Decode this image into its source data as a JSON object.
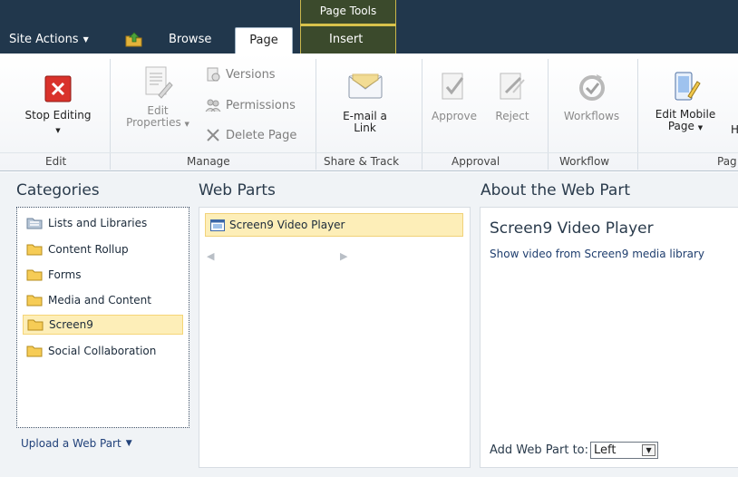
{
  "topbar": {
    "site_actions": "Site Actions",
    "context_group": "Page Tools",
    "tabs": {
      "browse": "Browse",
      "page": "Page",
      "insert": "Insert"
    }
  },
  "ribbon": {
    "stop_editing": "Stop Editing",
    "edit_properties_line1": "Edit",
    "edit_properties_line2": "Properties",
    "versions": "Versions",
    "permissions": "Permissions",
    "delete_page": "Delete Page",
    "email_link_line1": "E-mail a",
    "email_link_line2": "Link",
    "approve": "Approve",
    "reject": "Reject",
    "workflows": "Workflows",
    "edit_mobile_line1": "Edit Mobile",
    "edit_mobile_line2": "Page",
    "groups": {
      "edit": "Edit",
      "manage": "Manage",
      "share_track": "Share & Track",
      "approval": "Approval",
      "workflow": "Workflow",
      "page_partial": "Pag"
    }
  },
  "categories": {
    "title": "Categories",
    "items": [
      "Lists and Libraries",
      "Content Rollup",
      "Forms",
      "Media and Content",
      "Screen9",
      "Social Collaboration"
    ],
    "selected": "Screen9",
    "upload_link": "Upload a Web Part"
  },
  "web_parts": {
    "title": "Web Parts",
    "items": [
      "Screen9 Video Player"
    ]
  },
  "about": {
    "title": "About the Web Part",
    "part_name": "Screen9 Video Player",
    "description": "Show video from Screen9 media library",
    "add_to_label": "Add Web Part to:",
    "add_to_value": "Left"
  },
  "colors": {
    "topbar": "#21374c",
    "context_accent": "#d8c24b",
    "selection": "#fdeeb8",
    "link": "#22427a"
  }
}
